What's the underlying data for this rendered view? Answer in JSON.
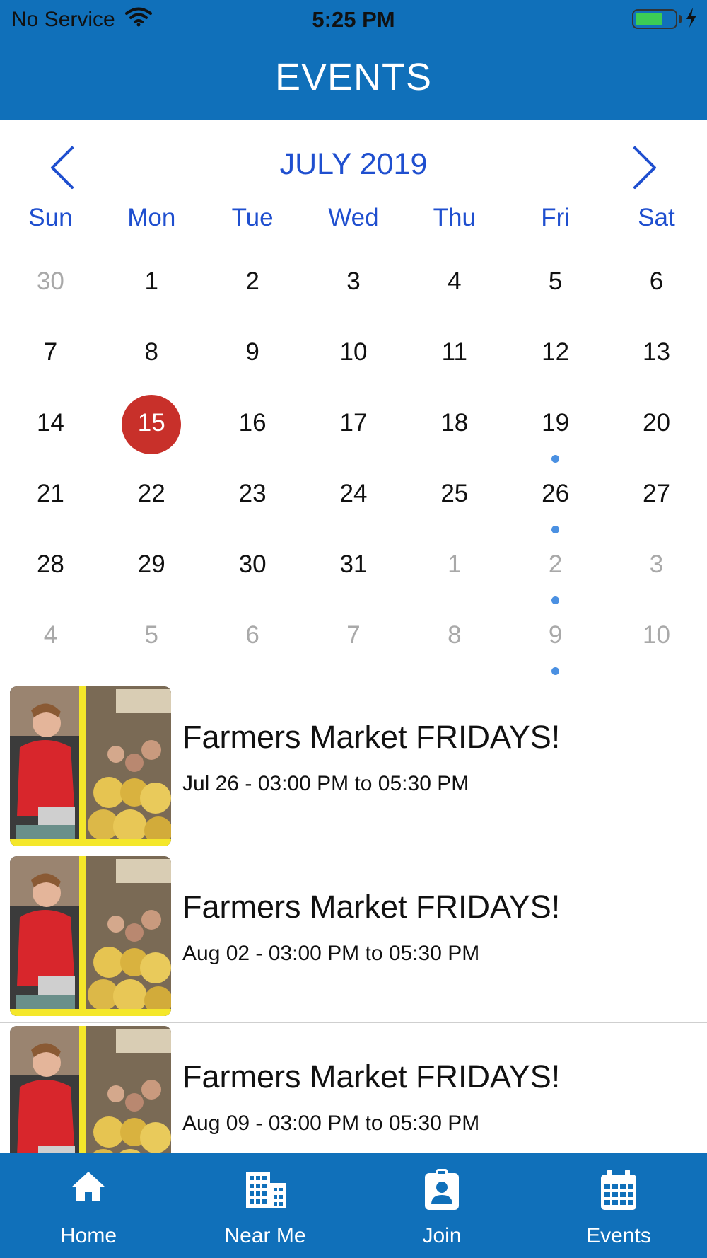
{
  "status_bar": {
    "carrier": "No Service",
    "time": "5:25 PM",
    "battery_level": 0.7,
    "battery_color": "#3ccc54"
  },
  "nav": {
    "title": "EVENTS"
  },
  "calendar": {
    "month_label": "JULY 2019",
    "prev_icon": "chevron-left-icon",
    "next_icon": "chevron-right-icon",
    "weekdays": [
      "Sun",
      "Mon",
      "Tue",
      "Wed",
      "Thu",
      "Fri",
      "Sat"
    ],
    "weeks": [
      [
        {
          "d": "30",
          "muted": true
        },
        {
          "d": "1"
        },
        {
          "d": "2"
        },
        {
          "d": "3"
        },
        {
          "d": "4"
        },
        {
          "d": "5"
        },
        {
          "d": "6"
        }
      ],
      [
        {
          "d": "7"
        },
        {
          "d": "8"
        },
        {
          "d": "9"
        },
        {
          "d": "10"
        },
        {
          "d": "11"
        },
        {
          "d": "12"
        },
        {
          "d": "13"
        }
      ],
      [
        {
          "d": "14"
        },
        {
          "d": "15",
          "today": true
        },
        {
          "d": "16"
        },
        {
          "d": "17"
        },
        {
          "d": "18"
        },
        {
          "d": "19",
          "event": true
        },
        {
          "d": "20"
        }
      ],
      [
        {
          "d": "21"
        },
        {
          "d": "22"
        },
        {
          "d": "23"
        },
        {
          "d": "24"
        },
        {
          "d": "25"
        },
        {
          "d": "26",
          "event": true
        },
        {
          "d": "27"
        }
      ],
      [
        {
          "d": "28"
        },
        {
          "d": "29"
        },
        {
          "d": "30"
        },
        {
          "d": "31"
        },
        {
          "d": "1",
          "muted": true
        },
        {
          "d": "2",
          "muted": true,
          "event": true
        },
        {
          "d": "3",
          "muted": true
        }
      ],
      [
        {
          "d": "4",
          "muted": true
        },
        {
          "d": "5",
          "muted": true
        },
        {
          "d": "6",
          "muted": true
        },
        {
          "d": "7",
          "muted": true
        },
        {
          "d": "8",
          "muted": true
        },
        {
          "d": "9",
          "muted": true,
          "event": true
        },
        {
          "d": "10",
          "muted": true
        }
      ]
    ],
    "today_color": "#c8302a",
    "event_dot_color": "#4a90e2",
    "accent_color": "#1f4fcf"
  },
  "events": [
    {
      "title": "Farmers Market FRIDAYS!",
      "time": "Jul 26 - 03:00 PM to 05:30 PM"
    },
    {
      "title": "Farmers Market FRIDAYS!",
      "time": "Aug 02 - 03:00 PM to 05:30 PM"
    },
    {
      "title": "Farmers Market FRIDAYS!",
      "time": "Aug 09 - 03:00 PM to 05:30 PM"
    }
  ],
  "tabbar": {
    "color": "#1070ba",
    "tabs": [
      {
        "label": "Home",
        "icon": "home-icon"
      },
      {
        "label": "Near Me",
        "icon": "building-icon"
      },
      {
        "label": "Join",
        "icon": "contact-card-icon"
      },
      {
        "label": "Events",
        "icon": "calendar-icon"
      }
    ]
  }
}
